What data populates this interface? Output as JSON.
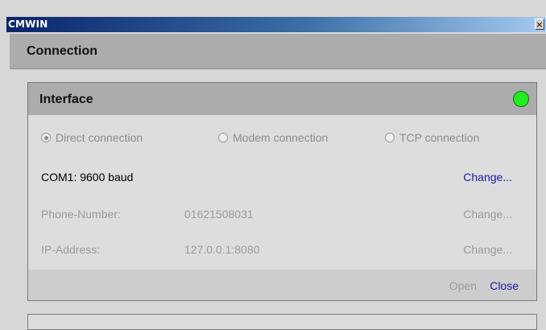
{
  "window": {
    "title": "CMWIN",
    "close_glyph": "×"
  },
  "connection": {
    "title": "Connection"
  },
  "interface": {
    "title": "Interface",
    "status_color": "#22ee22",
    "connection_types": [
      {
        "label": "Direct connection",
        "selected": true
      },
      {
        "label": "Modem connection",
        "selected": false
      },
      {
        "label": "TCP connection",
        "selected": false
      }
    ],
    "com": {
      "label": "COM1: 9600 baud",
      "change": "Change..."
    },
    "phone": {
      "label": "Phone-Number:",
      "value": "01621508031",
      "change": "Change..."
    },
    "ip": {
      "label": "IP-Address:",
      "value": "127.0.0.1:8080",
      "change": "Change..."
    },
    "footer": {
      "open": "Open",
      "close": "Close"
    }
  }
}
